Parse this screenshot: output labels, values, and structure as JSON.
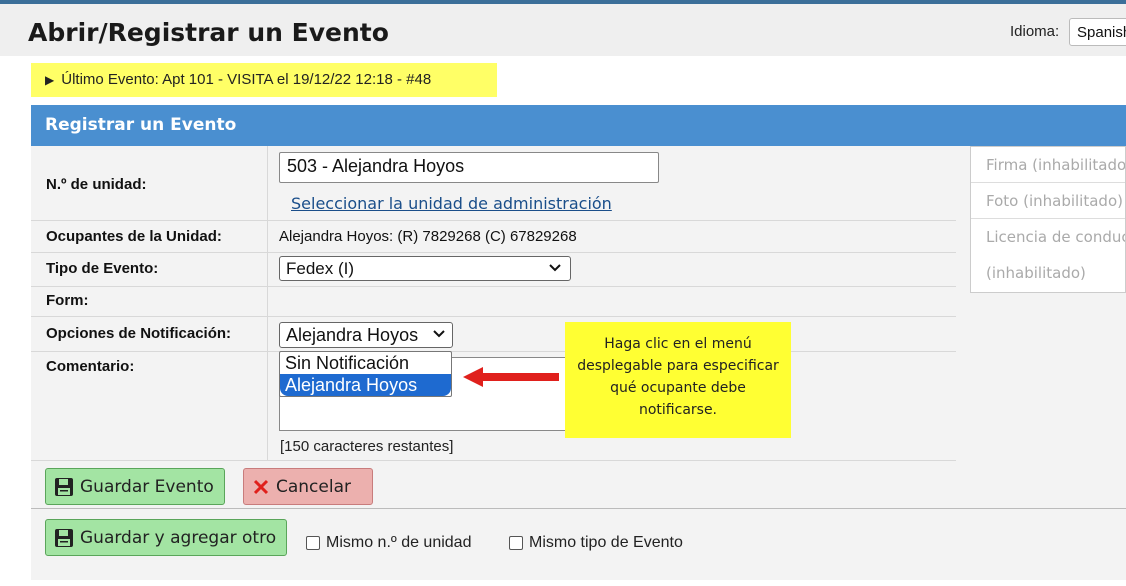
{
  "header": {
    "title": "Abrir/Registrar un Evento",
    "language_label": "Idioma:",
    "language_value": "Spanish"
  },
  "last_event": {
    "text": "Último Evento: Apt 101 - VISITA el 19/12/22 12:18 - #48"
  },
  "panel": {
    "title": "Registrar un Evento"
  },
  "form": {
    "unit_label": "N.º de unidad:",
    "unit_value": "503 - Alejandra Hoyos",
    "select_unit_link": "Seleccionar la unidad de administración",
    "occupants_label": "Ocupantes de la Unidad:",
    "occupants_value": "Alejandra Hoyos: (R) 7829268 (C) 67829268",
    "event_type_label": "Tipo de Evento:",
    "event_type_value": "Fedex (I)",
    "form_label": "Form:",
    "notification_label": "Opciones de Notificación:",
    "notification_value": "Alejandra Hoyos",
    "notification_options": [
      "Sin Notificación",
      "Alejandra Hoyos"
    ],
    "comment_label": "Comentario:",
    "chars_left": "[150 caracteres restantes]"
  },
  "tooltip": {
    "text": "Haga clic en el menú desplegable para especificar qué ocupante debe notificarse."
  },
  "side_panel": {
    "signature": "Firma (inhabilitado)",
    "photo": "Foto (inhabilitado)",
    "license": "Licencia de conducir",
    "license_status": "(inhabilitado)"
  },
  "buttons": {
    "save": "Guardar Evento",
    "cancel": "Cancelar",
    "save_add": "Guardar y agregar otro"
  },
  "checkboxes": {
    "same_unit": "Mismo n.º de unidad",
    "same_type": "Mismo tipo de Evento"
  },
  "colors": {
    "accent": "#4a8fd0",
    "highlight": "#ffff66",
    "tooltip": "#ffff33",
    "save_button": "#a3e4a3",
    "cancel_button": "#ecb0ae",
    "selected_option": "#1e6ad0",
    "arrow": "#e0201c"
  }
}
